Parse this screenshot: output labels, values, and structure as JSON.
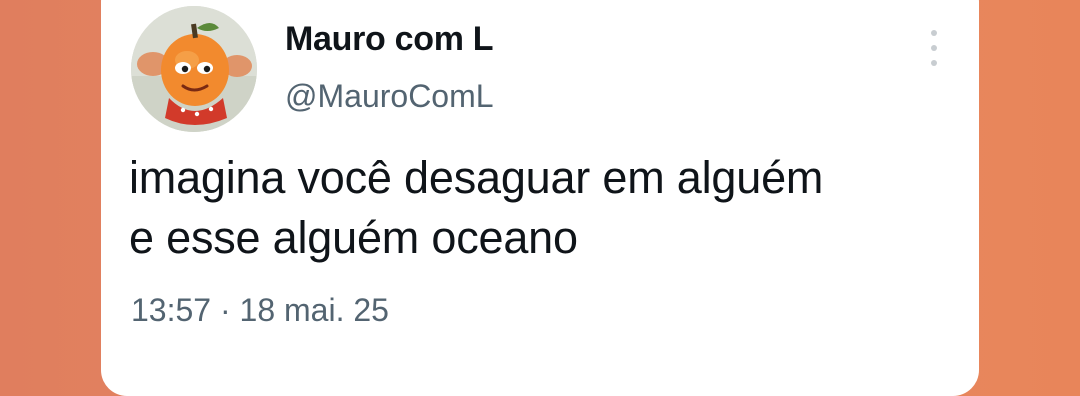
{
  "tweet": {
    "display_name": "Mauro com L",
    "handle": "@MauroComL",
    "text_lines": [
      "imagina você desaguar em alguém",
      "e esse alguém oceano"
    ],
    "time": "13:57",
    "separator": "·",
    "date": "18 mai. 25",
    "avatar_icon": "orange-character-avatar-icon",
    "more_icon": "more-options-icon"
  },
  "colors": {
    "background": "#e5835e",
    "card": "#ffffff",
    "text_primary": "#0f1419",
    "text_secondary": "#536471"
  }
}
